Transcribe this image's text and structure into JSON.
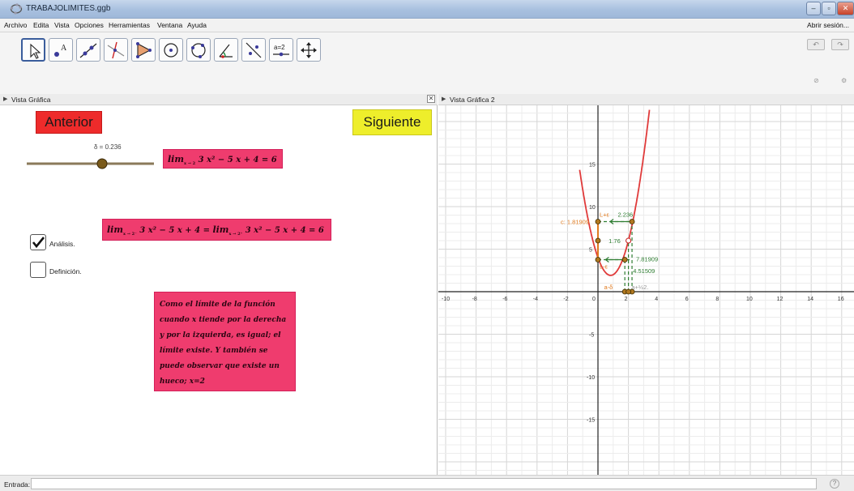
{
  "window": {
    "title": "TRABAJOLIMITES.ggb"
  },
  "menu": {
    "items": [
      "Archivo",
      "Edita",
      "Vista",
      "Opciones",
      "Herramientas",
      "Ventana",
      "Ayuda"
    ],
    "signin": "Abrir sesión..."
  },
  "tools": [
    "move",
    "point",
    "line",
    "perpendicular",
    "polygon",
    "circle",
    "circle-3pts",
    "angle",
    "reflect",
    "slider",
    "move-view"
  ],
  "tools_slider_text": "a=2",
  "view1": {
    "header": "Vista Gráfica",
    "prev_button": "Anterior",
    "next_button": "Siguiente",
    "slider_label": "δ = 0.236",
    "slider_value": 0.236,
    "formula1": {
      "lim": "lim",
      "sub": "x → 2",
      "expr": "3 x² − 5 x + 4 = 6"
    },
    "formula2": {
      "lim": "lim",
      "sub1": "x → 2⁻",
      "expr1": "3 x² − 5 x + 4 =",
      "sub2": "x → 2⁺",
      "expr2": "3 x² − 5 x + 4 = 6"
    },
    "checkbox_analysis": {
      "label": "Análisis.",
      "checked": true
    },
    "checkbox_definition": {
      "label": "Definición.",
      "checked": false
    },
    "explanation": "Como el límite de la función cuando x tiende por la derecha y por la izquierda, es igual; el límite existe. Y también se puede observar que existe un hueco; x=2"
  },
  "view2": {
    "header": "Vista Gráfica 2",
    "x_ticks": [
      "-10",
      "-8",
      "-6",
      "-4",
      "-2",
      "0",
      "2",
      "4",
      "6",
      "8",
      "10",
      "12",
      "14",
      "16"
    ],
    "y_ticks": [
      "15",
      "10",
      "5",
      "-5",
      "-10",
      "-15"
    ],
    "labels": {
      "c_value": "c: 1.81909",
      "l_plus_eps": "L+ε",
      "eps_value": "2.236",
      "value_176": "1.76",
      "l_minus_eps": "L-ε",
      "value_781": "7.81909",
      "value_451": "4.51509",
      "a_minus_delta": "a-δ",
      "a_plus_delta": "a+½2.",
      "slider_tool": "a=2"
    },
    "colors": {
      "curve": "#e03a3a",
      "guide": "#2e7d32",
      "highlight": "#e07b20"
    }
  },
  "input_bar": {
    "label": "Entrada:"
  }
}
